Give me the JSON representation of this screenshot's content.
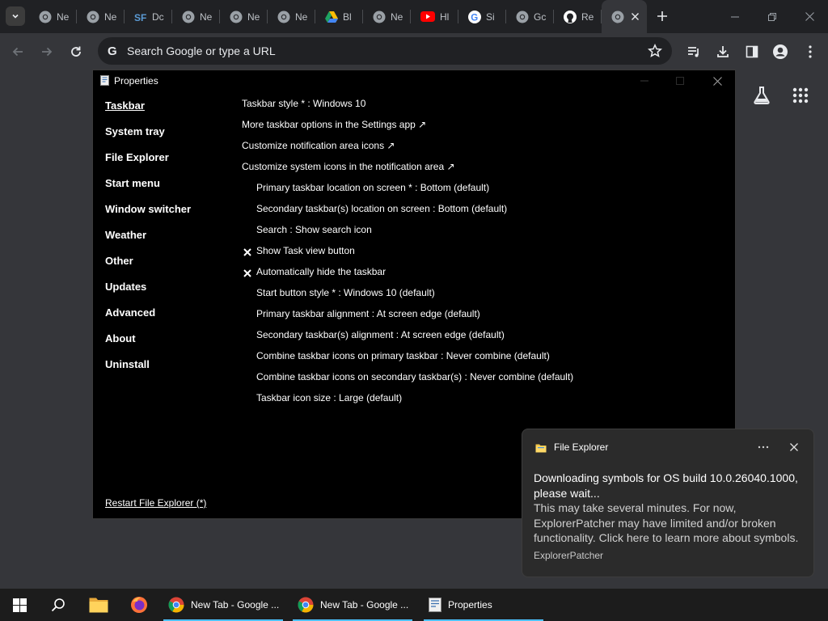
{
  "browser": {
    "tabs": [
      {
        "icon": "chrome-icon",
        "title": "Ne"
      },
      {
        "icon": "chrome-icon",
        "title": "Ne"
      },
      {
        "icon": "sourceforge-icon",
        "title": "Dc"
      },
      {
        "icon": "chrome-icon",
        "title": "Ne"
      },
      {
        "icon": "chrome-icon",
        "title": "Ne"
      },
      {
        "icon": "chrome-icon",
        "title": "Ne"
      },
      {
        "icon": "google-drive-icon",
        "title": "Bl"
      },
      {
        "icon": "chrome-icon",
        "title": "Ne"
      },
      {
        "icon": "youtube-icon",
        "title": "Hl"
      },
      {
        "icon": "google-icon",
        "title": "Si"
      },
      {
        "icon": "chrome-icon",
        "title": "Gc"
      },
      {
        "icon": "github-icon",
        "title": "Re"
      },
      {
        "icon": "chrome-icon",
        "title": ""
      }
    ],
    "omnibox_placeholder": "Search Google or type a URL"
  },
  "properties": {
    "title": "Properties",
    "sidebar": [
      "Taskbar",
      "System tray",
      "File Explorer",
      "Start menu",
      "Window switcher",
      "Weather",
      "Other",
      "Updates",
      "Advanced",
      "About",
      "Uninstall"
    ],
    "restart_link": "Restart File Explorer (*)",
    "options": [
      {
        "text": "Taskbar style * : Windows 10",
        "indent": false,
        "checked": false
      },
      {
        "text": "More taskbar options in the Settings app ↗",
        "indent": false,
        "checked": false
      },
      {
        "text": "Customize notification area icons ↗",
        "indent": false,
        "checked": false
      },
      {
        "text": "Customize system icons in the notification area ↗",
        "indent": false,
        "checked": false
      },
      {
        "text": "Primary taskbar location on screen * : Bottom (default)",
        "indent": true,
        "checked": false
      },
      {
        "text": "Secondary taskbar(s) location on screen : Bottom (default)",
        "indent": true,
        "checked": false
      },
      {
        "text": "Search : Show search icon",
        "indent": true,
        "checked": false
      },
      {
        "text": "Show Task view button",
        "indent": true,
        "checked": true
      },
      {
        "text": "Automatically hide the taskbar",
        "indent": true,
        "checked": true
      },
      {
        "text": "Start button style * : Windows 10 (default)",
        "indent": true,
        "checked": false
      },
      {
        "text": "Primary taskbar alignment : At screen edge (default)",
        "indent": true,
        "checked": false
      },
      {
        "text": "Secondary taskbar(s) alignment : At screen edge (default)",
        "indent": true,
        "checked": false
      },
      {
        "text": "Combine taskbar icons on primary taskbar : Never combine (default)",
        "indent": true,
        "checked": false
      },
      {
        "text": "Combine taskbar icons on secondary taskbar(s) : Never combine (default)",
        "indent": true,
        "checked": false
      },
      {
        "text": "Taskbar icon size : Large (default)",
        "indent": true,
        "checked": false
      }
    ]
  },
  "toast": {
    "app": "File Explorer",
    "title": "Downloading symbols for OS build 10.0.26040.1000, please wait...",
    "body": "This may take several minutes. For now, ExplorerPatcher may have limited and/or broken functionality. Click here to learn more about symbols.",
    "attribution": "ExplorerPatcher"
  },
  "taskbar": {
    "tasks": [
      {
        "icon": "chrome-icon",
        "label": "New Tab - Google ..."
      },
      {
        "icon": "chrome-icon",
        "label": "New Tab - Google ..."
      },
      {
        "icon": "properties-window-icon",
        "label": "Properties"
      }
    ]
  },
  "colors": {
    "page_bg": "#35363a",
    "window_bg": "#000000",
    "accent": "#4cc2ff"
  }
}
